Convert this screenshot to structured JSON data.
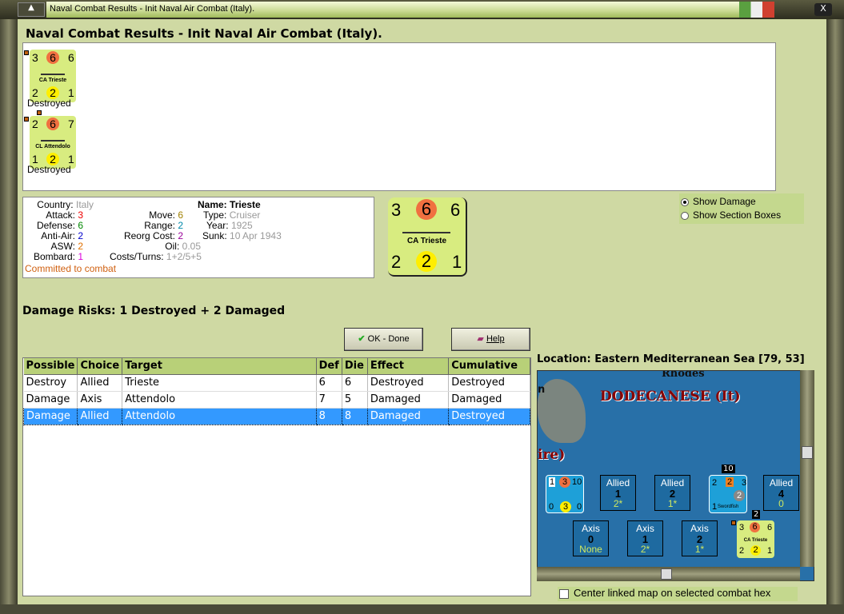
{
  "window": {
    "title": "Naval Combat Results - Init Naval Air Combat (Italy).",
    "close_label": "X"
  },
  "heading": "Naval Combat Results - Init Naval Air Combat (Italy).",
  "results": [
    {
      "name": "CA Trieste",
      "top": [
        "3",
        "6",
        "6"
      ],
      "bottom": [
        "2",
        "2",
        "1"
      ],
      "status": "Destroyed"
    },
    {
      "name": "CL Attendolo",
      "top": [
        "2",
        "6",
        "7"
      ],
      "bottom": [
        "1",
        "2",
        "1"
      ],
      "status": "Destroyed"
    }
  ],
  "info": {
    "country_label": "Country:",
    "country": "Italy",
    "attack_label": "Attack:",
    "attack": "3",
    "defense_label": "Defense:",
    "defense": "6",
    "antiair_label": "Anti-Air:",
    "antiair": "2",
    "asw_label": "ASW:",
    "asw": "2",
    "bombard_label": "Bombard:",
    "bombard": "1",
    "move_label": "Move:",
    "move": "6",
    "range_label": "Range:",
    "range": "2",
    "reorg_label": "Reorg Cost:",
    "reorg": "2",
    "oil_label": "Oil:",
    "oil": "0.05",
    "costs_label": "Costs/Turns:",
    "costs": "1+2/5+5",
    "name_label": "Name:",
    "name": "Trieste",
    "type_label": "Type:",
    "type": "Cruiser",
    "year_label": "Year:",
    "year": "1925",
    "sunk_label": "Sunk:",
    "sunk": "10 Apr 1943",
    "status": "Committed to combat"
  },
  "big_counter": {
    "name": "CA Trieste",
    "top": [
      "3",
      "6",
      "6"
    ],
    "bottom": [
      "2",
      "2",
      "1"
    ]
  },
  "options": {
    "show_damage": "Show Damage",
    "show_sections": "Show Section Boxes"
  },
  "risks": "Damage Risks:  1 Destroyed + 2 Damaged",
  "buttons": {
    "ok": "OK - Done",
    "help": "Help"
  },
  "table": {
    "headers": [
      "Possible",
      "Choice",
      "Target",
      "Def",
      "Die",
      "Effect",
      "Cumulative"
    ],
    "rows": [
      [
        "Destroy",
        "Allied",
        "Trieste",
        "6",
        "6",
        "Destroyed",
        "Destroyed"
      ],
      [
        "Damage",
        "Axis",
        "Attendolo",
        "7",
        "5",
        "Damaged",
        "Damaged"
      ],
      [
        "Damage",
        "Allied",
        "Attendolo",
        "8",
        "8",
        "Damaged",
        "Destroyed"
      ]
    ]
  },
  "location": "Location:  Eastern Mediterranean Sea [79, 53]",
  "map": {
    "region": "DODECANESE (It)",
    "rhodes": "Rhodes",
    "ire": "ire)",
    "left_n": "n",
    "allied_counter": {
      "top": [
        "1",
        "3",
        "10"
      ],
      "bottom": [
        "0",
        "3",
        "0"
      ]
    },
    "allied_boxes": [
      {
        "side": "Allied",
        "num": "1",
        "val": "2*"
      },
      {
        "side": "Allied",
        "num": "2",
        "val": "1*"
      },
      {
        "side": "Allied",
        "num": "4",
        "val": "0"
      }
    ],
    "axis_boxes": [
      {
        "side": "Axis",
        "num": "0",
        "val": "None"
      },
      {
        "side": "Axis",
        "num": "1",
        "val": "2*"
      },
      {
        "side": "Axis",
        "num": "2",
        "val": "1*"
      }
    ],
    "air": {
      "name": "Swordfish",
      "stack": "10",
      "top": [
        "2",
        "2",
        "3"
      ],
      "mid": "2",
      "bottom": "1"
    },
    "trieste": {
      "name": "CA Trieste",
      "stack": "2",
      "top": [
        "3",
        "6",
        "6"
      ],
      "bottom": [
        "2",
        "2",
        "1"
      ]
    }
  },
  "center_map": "Center linked map on selected combat hex"
}
